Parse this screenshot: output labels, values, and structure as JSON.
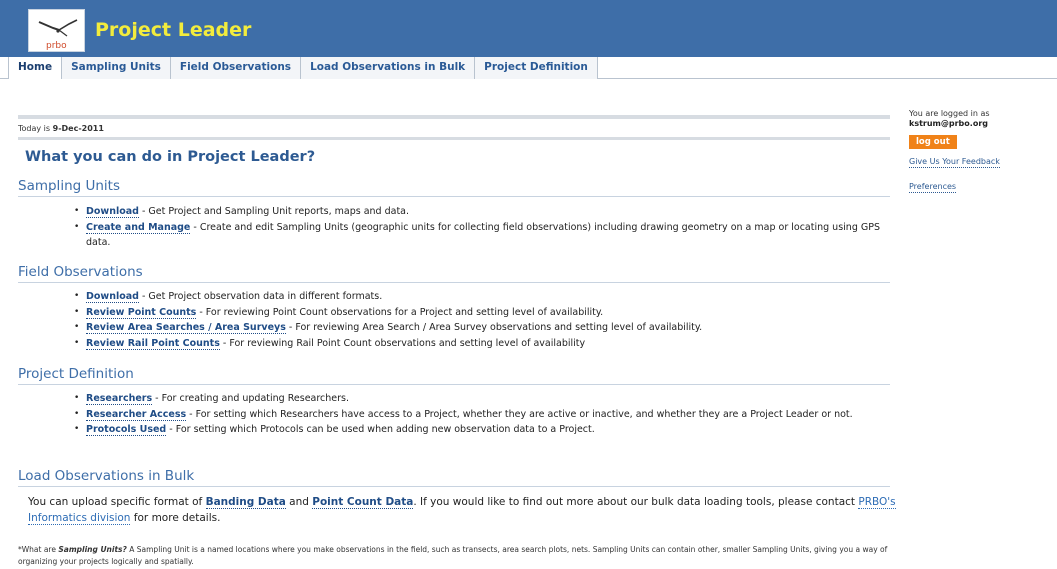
{
  "header": {
    "logo_text": "prbo",
    "app_title": "Project Leader"
  },
  "tabs": [
    {
      "label": "Home",
      "active": true
    },
    {
      "label": "Sampling Units"
    },
    {
      "label": "Field Observations"
    },
    {
      "label": "Load Observations in Bulk"
    },
    {
      "label": "Project Definition"
    }
  ],
  "today": {
    "prefix": "Today is ",
    "date": "9-Dec-2011"
  },
  "heading": "What you can do in Project Leader?",
  "sections": {
    "sampling_units": {
      "title": "Sampling Units",
      "items": [
        {
          "link": "Download",
          "text": " - Get Project and Sampling Unit reports, maps and data."
        },
        {
          "link": "Create and Manage",
          "text": " - Create and edit Sampling Units (geographic units for collecting field observations) including drawing geometry on a map or locating using GPS data."
        }
      ]
    },
    "field_observations": {
      "title": "Field Observations",
      "items": [
        {
          "link": "Download",
          "text": " - Get Project observation data in different formats."
        },
        {
          "link": "Review Point Counts",
          "text": " - For reviewing Point Count observations for a Project and setting level of availability."
        },
        {
          "link": "Review Area Searches / Area Surveys",
          "text": " - For reviewing Area Search / Area Survey observations and setting level of availability."
        },
        {
          "link": "Review Rail Point Counts",
          "text": " - For reviewing Rail Point Count observations and setting level of availability"
        }
      ]
    },
    "project_definition": {
      "title": "Project Definition",
      "items": [
        {
          "link": "Researchers",
          "text": " - For creating and updating Researchers."
        },
        {
          "link": "Researcher Access",
          "text": " - For setting which Researchers have access to a Project, whether they are active or inactive, and whether they are a Project Leader or not."
        },
        {
          "link": "Protocols Used",
          "text": " - For setting which Protocols can be used when adding new observation data to a Project."
        }
      ]
    },
    "load_bulk": {
      "title": "Load Observations in Bulk",
      "para_1": "You can upload specific format of ",
      "link_banding": "Banding Data",
      "para_2": " and ",
      "link_pointcount": "Point Count Data",
      "para_3": ". If you would like to find out more about our bulk data loading tools, please contact ",
      "link_informatics": "PRBO's Informatics division",
      "para_4": " for more details."
    }
  },
  "footnote": {
    "prefix": "*What are ",
    "term": "Sampling Units?",
    "text": " A Sampling Unit is a named locations where you make observations in the field, such as transects, area search plots, nets. Sampling Units can contain other, smaller Sampling Units, giving you a way of organizing your projects logically and spatially."
  },
  "sidebar": {
    "logged_in_label": "You are logged in as",
    "user": "kstrum@prbo.org",
    "logout_label": "log out",
    "feedback_link": "Give Us Your Feedback",
    "preferences_link": "Preferences"
  },
  "colors": {
    "header_bg": "#3e6ea8",
    "title_yellow": "#f2ec3d",
    "link_blue": "#1f4c86",
    "logout_orange": "#f08218"
  }
}
